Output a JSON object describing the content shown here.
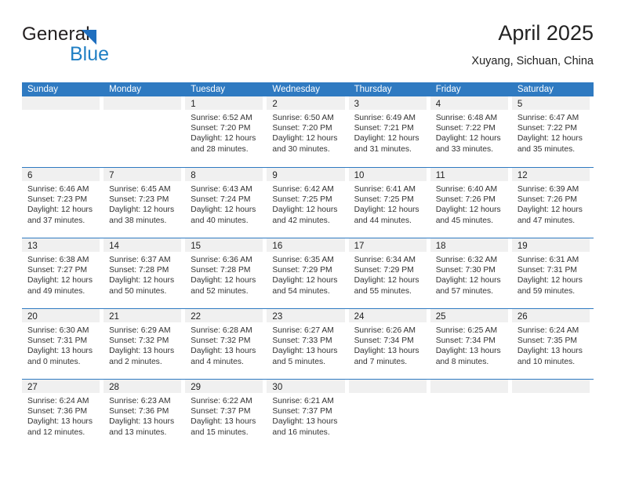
{
  "brand": {
    "name_top": "General",
    "name_bottom": "Blue",
    "triangle_color": "#1f6fbf",
    "blue_text_color": "#1f7fc4"
  },
  "header": {
    "title": "April 2025",
    "subtitle": "Xuyang, Sichuan, China"
  },
  "theme": {
    "header_blue": "#2f7ac1",
    "day_band_gray": "#f0f0f0",
    "divider_blue": "#2f7ac1"
  },
  "weekdays": [
    "Sunday",
    "Monday",
    "Tuesday",
    "Wednesday",
    "Thursday",
    "Friday",
    "Saturday"
  ],
  "weeks": [
    {
      "days": [
        {
          "num": "",
          "l1": "",
          "l2": "",
          "l3": "",
          "l4": ""
        },
        {
          "num": "",
          "l1": "",
          "l2": "",
          "l3": "",
          "l4": ""
        },
        {
          "num": "1",
          "l1": "Sunrise: 6:52 AM",
          "l2": "Sunset: 7:20 PM",
          "l3": "Daylight: 12 hours",
          "l4": "and 28 minutes."
        },
        {
          "num": "2",
          "l1": "Sunrise: 6:50 AM",
          "l2": "Sunset: 7:20 PM",
          "l3": "Daylight: 12 hours",
          "l4": "and 30 minutes."
        },
        {
          "num": "3",
          "l1": "Sunrise: 6:49 AM",
          "l2": "Sunset: 7:21 PM",
          "l3": "Daylight: 12 hours",
          "l4": "and 31 minutes."
        },
        {
          "num": "4",
          "l1": "Sunrise: 6:48 AM",
          "l2": "Sunset: 7:22 PM",
          "l3": "Daylight: 12 hours",
          "l4": "and 33 minutes."
        },
        {
          "num": "5",
          "l1": "Sunrise: 6:47 AM",
          "l2": "Sunset: 7:22 PM",
          "l3": "Daylight: 12 hours",
          "l4": "and 35 minutes."
        }
      ]
    },
    {
      "days": [
        {
          "num": "6",
          "l1": "Sunrise: 6:46 AM",
          "l2": "Sunset: 7:23 PM",
          "l3": "Daylight: 12 hours",
          "l4": "and 37 minutes."
        },
        {
          "num": "7",
          "l1": "Sunrise: 6:45 AM",
          "l2": "Sunset: 7:23 PM",
          "l3": "Daylight: 12 hours",
          "l4": "and 38 minutes."
        },
        {
          "num": "8",
          "l1": "Sunrise: 6:43 AM",
          "l2": "Sunset: 7:24 PM",
          "l3": "Daylight: 12 hours",
          "l4": "and 40 minutes."
        },
        {
          "num": "9",
          "l1": "Sunrise: 6:42 AM",
          "l2": "Sunset: 7:25 PM",
          "l3": "Daylight: 12 hours",
          "l4": "and 42 minutes."
        },
        {
          "num": "10",
          "l1": "Sunrise: 6:41 AM",
          "l2": "Sunset: 7:25 PM",
          "l3": "Daylight: 12 hours",
          "l4": "and 44 minutes."
        },
        {
          "num": "11",
          "l1": "Sunrise: 6:40 AM",
          "l2": "Sunset: 7:26 PM",
          "l3": "Daylight: 12 hours",
          "l4": "and 45 minutes."
        },
        {
          "num": "12",
          "l1": "Sunrise: 6:39 AM",
          "l2": "Sunset: 7:26 PM",
          "l3": "Daylight: 12 hours",
          "l4": "and 47 minutes."
        }
      ]
    },
    {
      "days": [
        {
          "num": "13",
          "l1": "Sunrise: 6:38 AM",
          "l2": "Sunset: 7:27 PM",
          "l3": "Daylight: 12 hours",
          "l4": "and 49 minutes."
        },
        {
          "num": "14",
          "l1": "Sunrise: 6:37 AM",
          "l2": "Sunset: 7:28 PM",
          "l3": "Daylight: 12 hours",
          "l4": "and 50 minutes."
        },
        {
          "num": "15",
          "l1": "Sunrise: 6:36 AM",
          "l2": "Sunset: 7:28 PM",
          "l3": "Daylight: 12 hours",
          "l4": "and 52 minutes."
        },
        {
          "num": "16",
          "l1": "Sunrise: 6:35 AM",
          "l2": "Sunset: 7:29 PM",
          "l3": "Daylight: 12 hours",
          "l4": "and 54 minutes."
        },
        {
          "num": "17",
          "l1": "Sunrise: 6:34 AM",
          "l2": "Sunset: 7:29 PM",
          "l3": "Daylight: 12 hours",
          "l4": "and 55 minutes."
        },
        {
          "num": "18",
          "l1": "Sunrise: 6:32 AM",
          "l2": "Sunset: 7:30 PM",
          "l3": "Daylight: 12 hours",
          "l4": "and 57 minutes."
        },
        {
          "num": "19",
          "l1": "Sunrise: 6:31 AM",
          "l2": "Sunset: 7:31 PM",
          "l3": "Daylight: 12 hours",
          "l4": "and 59 minutes."
        }
      ]
    },
    {
      "days": [
        {
          "num": "20",
          "l1": "Sunrise: 6:30 AM",
          "l2": "Sunset: 7:31 PM",
          "l3": "Daylight: 13 hours",
          "l4": "and 0 minutes."
        },
        {
          "num": "21",
          "l1": "Sunrise: 6:29 AM",
          "l2": "Sunset: 7:32 PM",
          "l3": "Daylight: 13 hours",
          "l4": "and 2 minutes."
        },
        {
          "num": "22",
          "l1": "Sunrise: 6:28 AM",
          "l2": "Sunset: 7:32 PM",
          "l3": "Daylight: 13 hours",
          "l4": "and 4 minutes."
        },
        {
          "num": "23",
          "l1": "Sunrise: 6:27 AM",
          "l2": "Sunset: 7:33 PM",
          "l3": "Daylight: 13 hours",
          "l4": "and 5 minutes."
        },
        {
          "num": "24",
          "l1": "Sunrise: 6:26 AM",
          "l2": "Sunset: 7:34 PM",
          "l3": "Daylight: 13 hours",
          "l4": "and 7 minutes."
        },
        {
          "num": "25",
          "l1": "Sunrise: 6:25 AM",
          "l2": "Sunset: 7:34 PM",
          "l3": "Daylight: 13 hours",
          "l4": "and 8 minutes."
        },
        {
          "num": "26",
          "l1": "Sunrise: 6:24 AM",
          "l2": "Sunset: 7:35 PM",
          "l3": "Daylight: 13 hours",
          "l4": "and 10 minutes."
        }
      ]
    },
    {
      "days": [
        {
          "num": "27",
          "l1": "Sunrise: 6:24 AM",
          "l2": "Sunset: 7:36 PM",
          "l3": "Daylight: 13 hours",
          "l4": "and 12 minutes."
        },
        {
          "num": "28",
          "l1": "Sunrise: 6:23 AM",
          "l2": "Sunset: 7:36 PM",
          "l3": "Daylight: 13 hours",
          "l4": "and 13 minutes."
        },
        {
          "num": "29",
          "l1": "Sunrise: 6:22 AM",
          "l2": "Sunset: 7:37 PM",
          "l3": "Daylight: 13 hours",
          "l4": "and 15 minutes."
        },
        {
          "num": "30",
          "l1": "Sunrise: 6:21 AM",
          "l2": "Sunset: 7:37 PM",
          "l3": "Daylight: 13 hours",
          "l4": "and 16 minutes."
        },
        {
          "num": "",
          "l1": "",
          "l2": "",
          "l3": "",
          "l4": ""
        },
        {
          "num": "",
          "l1": "",
          "l2": "",
          "l3": "",
          "l4": ""
        },
        {
          "num": "",
          "l1": "",
          "l2": "",
          "l3": "",
          "l4": ""
        }
      ]
    }
  ]
}
